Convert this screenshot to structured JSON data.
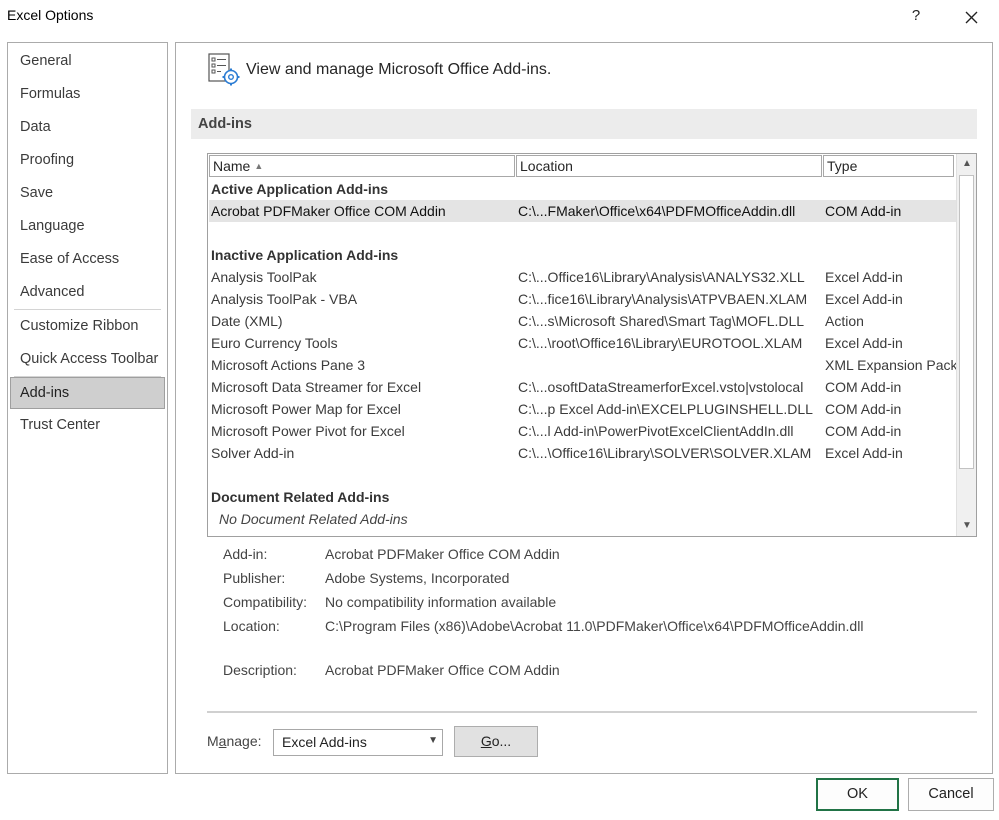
{
  "window": {
    "title": "Excel Options",
    "help_label": "?"
  },
  "sidebar": {
    "items": [
      {
        "label": "General"
      },
      {
        "label": "Formulas"
      },
      {
        "label": "Data"
      },
      {
        "label": "Proofing"
      },
      {
        "label": "Save"
      },
      {
        "label": "Language"
      },
      {
        "label": "Ease of Access"
      },
      {
        "label": "Advanced"
      },
      {
        "label": "Customize Ribbon"
      },
      {
        "label": "Quick Access Toolbar"
      },
      {
        "label": "Add-ins"
      },
      {
        "label": "Trust Center"
      }
    ],
    "active": "Add-ins"
  },
  "header": {
    "text": "View and manage Microsoft Office Add-ins."
  },
  "section": {
    "title": "Add-ins"
  },
  "table": {
    "columns": [
      "Name",
      "Location",
      "Type"
    ],
    "sort_indicator": "▲",
    "groups": {
      "active": "Active Application Add-ins",
      "inactive": "Inactive Application Add-ins",
      "document": "Document Related Add-ins"
    },
    "active_rows": [
      {
        "name": "Acrobat PDFMaker Office COM Addin",
        "location": "C:\\...FMaker\\Office\\x64\\PDFMOfficeAddin.dll",
        "type": "COM Add-in"
      }
    ],
    "inactive_rows": [
      {
        "name": "Analysis ToolPak",
        "location": "C:\\...Office16\\Library\\Analysis\\ANALYS32.XLL",
        "type": "Excel Add-in"
      },
      {
        "name": "Analysis ToolPak - VBA",
        "location": "C:\\...fice16\\Library\\Analysis\\ATPVBAEN.XLAM",
        "type": "Excel Add-in"
      },
      {
        "name": "Date (XML)",
        "location": "C:\\...s\\Microsoft Shared\\Smart Tag\\MOFL.DLL",
        "type": "Action"
      },
      {
        "name": "Euro Currency Tools",
        "location": "C:\\...\\root\\Office16\\Library\\EUROTOOL.XLAM",
        "type": "Excel Add-in"
      },
      {
        "name": "Microsoft Actions Pane 3",
        "location": "",
        "type": "XML Expansion Pack"
      },
      {
        "name": "Microsoft Data Streamer for Excel",
        "location": "C:\\...osoftDataStreamerforExcel.vsto|vstolocal",
        "type": "COM Add-in"
      },
      {
        "name": "Microsoft Power Map for Excel",
        "location": "C:\\...p Excel Add-in\\EXCELPLUGINSHELL.DLL",
        "type": "COM Add-in"
      },
      {
        "name": "Microsoft Power Pivot for Excel",
        "location": "C:\\...l Add-in\\PowerPivotExcelClientAddIn.dll",
        "type": "COM Add-in"
      },
      {
        "name": "Solver Add-in",
        "location": "C:\\...\\Office16\\Library\\SOLVER\\SOLVER.XLAM",
        "type": "Excel Add-in"
      }
    ],
    "document_empty": "No Document Related Add-ins"
  },
  "details": {
    "addin_label": "Add-in:",
    "addin_value": "Acrobat PDFMaker Office COM Addin",
    "publisher_label": "Publisher:",
    "publisher_value": "Adobe Systems, Incorporated",
    "compat_label": "Compatibility:",
    "compat_value": "No compatibility information available",
    "location_label": "Location:",
    "location_value": "C:\\Program Files (x86)\\Adobe\\Acrobat 11.0\\PDFMaker\\Office\\x64\\PDFMOfficeAddin.dll",
    "description_label": "Description:",
    "description_value": "Acrobat PDFMaker Office COM Addin"
  },
  "manage": {
    "label_prefix": "M",
    "label_accel": "a",
    "label_suffix": "nage:",
    "selected": "Excel Add-ins",
    "go_accel": "G",
    "go_rest": "o..."
  },
  "footer": {
    "ok": "OK",
    "cancel": "Cancel"
  },
  "colors": {
    "accent": "#217346",
    "selected_row": "#e4e4e4",
    "section_bar": "#ececec"
  }
}
